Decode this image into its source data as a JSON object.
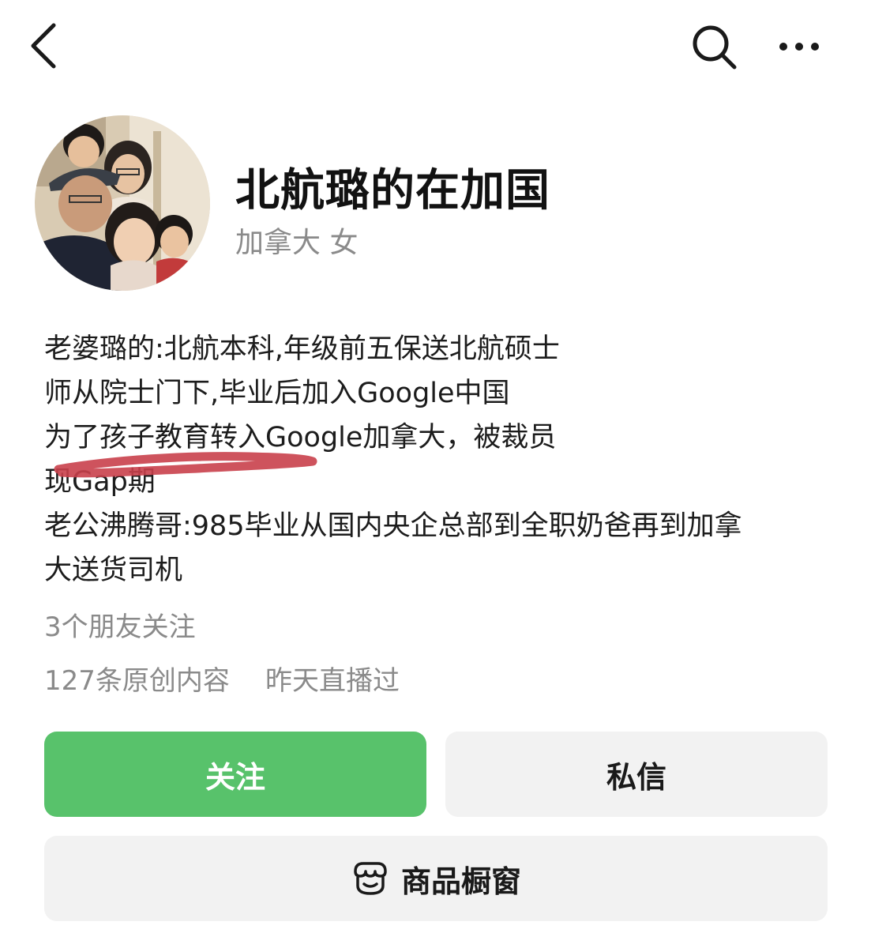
{
  "header": {
    "back_icon": "chevron-left-icon",
    "search_icon": "search-icon",
    "more_icon": "more-horizontal-icon"
  },
  "profile": {
    "name": "北航璐的在加国",
    "subinfo": "加拿大 女",
    "bio_lines": [
      "老婆璐的:北航本科,年级前五保送北航硕士",
      "师从院士门下,毕业后加入Google中国",
      "为了孩子教育转入Google加拿大，被裁员",
      "现Gap期",
      "老公沸腾哥:985毕业从国内央企总部到全职奶爸再到加拿",
      "大送货司机"
    ],
    "followers_text": "3个朋友关注",
    "content_count_text": "127条原创内容",
    "live_status_text": "昨天直播过"
  },
  "actions": {
    "follow_label": "关注",
    "message_label": "私信",
    "shop_label": "商品橱窗",
    "shop_icon": "shop-icon"
  },
  "colors": {
    "accent_green": "#58c26b",
    "button_gray": "#f2f2f2",
    "annotation_red": "#c9404b",
    "secondary_text": "#8a8a8a"
  }
}
